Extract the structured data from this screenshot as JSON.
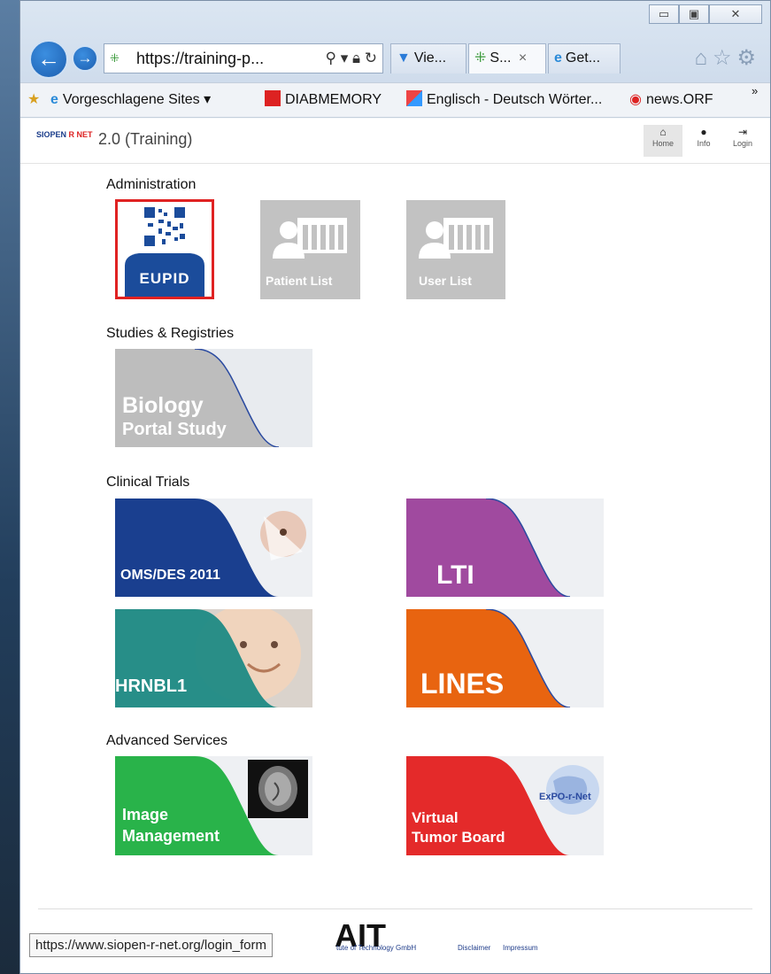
{
  "browser": {
    "address_url": "https://training-p...",
    "tabs": [
      {
        "label": "Vie...",
        "icon": "filter-icon"
      },
      {
        "label": "S...",
        "icon": "siopen-icon"
      },
      {
        "label": "Get...",
        "icon": "ie-icon"
      }
    ],
    "tab_close": "×",
    "favorites": [
      {
        "label": "Vorgeschlagene Sites ▾"
      },
      {
        "label": "DIABMEMORY"
      },
      {
        "label": "Englisch - Deutsch Wörter..."
      },
      {
        "label": "news.ORF"
      }
    ],
    "overflow": "»",
    "status_url": "https://www.siopen-r-net.org/login_form"
  },
  "site": {
    "logo_prefix": "SIOPEN",
    "logo_suffix": "R NET",
    "title": "2.0 (Training)",
    "nav": [
      {
        "label": "Home",
        "icon": "home-icon"
      },
      {
        "label": "Info",
        "icon": "info-icon"
      },
      {
        "label": "Login",
        "icon": "login-icon"
      }
    ]
  },
  "sections": {
    "administration": "Administration",
    "studies": "Studies & Registries",
    "clinical": "Clinical Trials",
    "advanced": "Advanced Services"
  },
  "tiles": {
    "eupid": "EUPID",
    "patient_list": "Patient List",
    "user_list": "User List",
    "biology_line1": "Biology",
    "biology_line2": "Portal Study",
    "omsdes": "OMS/DES 2011",
    "lti": "LTI",
    "hrnbl1": "HRNBL1",
    "lines": "LINES",
    "image_line1": "Image",
    "image_line2": "Management",
    "vtb_line1": "Virtual",
    "vtb_line2": "Tumor Board",
    "exponet": "ExPO-r-Net"
  },
  "footer": {
    "ait": "AIT",
    "company": "tute of Technology GmbH",
    "disclaimer": "Disclaimer",
    "impressum": "Impressum"
  },
  "colors": {
    "omsdes": "#1a3f8f",
    "lti": "#a04a9f",
    "hrnbl1": "#1d8a84",
    "lines": "#e86410",
    "image": "#29b34a",
    "vtb": "#e42a2a",
    "eupid_blue": "#1b4c9b",
    "eupid_border": "#e02222",
    "grey_tile": "#c2c2c2"
  }
}
